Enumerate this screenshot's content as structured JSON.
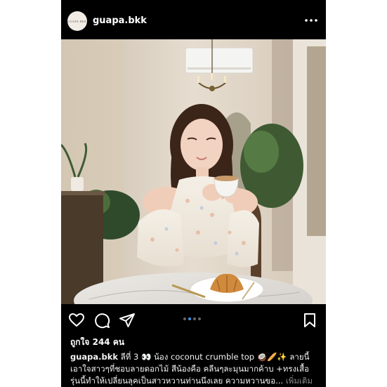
{
  "post": {
    "username": "guapa.bkk",
    "avatar_text": "GUAPA.BKK",
    "likes": "ถูกใจ 244 คน",
    "caption_username": "guapa.bkk",
    "caption_line1": "ลีที่ 3 👀 น้อง coconut crumble top 🥥🥖✨ ลายนี้",
    "caption_line2": "เอาใจสาวๆที่ชอบลายดอกไม้ สีน้องคือ คลีนๆละมุนมากค้าบ +ทรงเสื้อ",
    "caption_line3": "รุ่นนี้ทำให้เปลี่ยนลุคเป็นสาวหวานท่านนึงเลย ความหวานขอ...",
    "more_label": "เพิ่มเติม"
  },
  "carousel": {
    "count": 4,
    "active_index": 1
  },
  "colors": {
    "background": "#000000",
    "accent": "#3897f0",
    "muted": "#8e8e8e"
  }
}
